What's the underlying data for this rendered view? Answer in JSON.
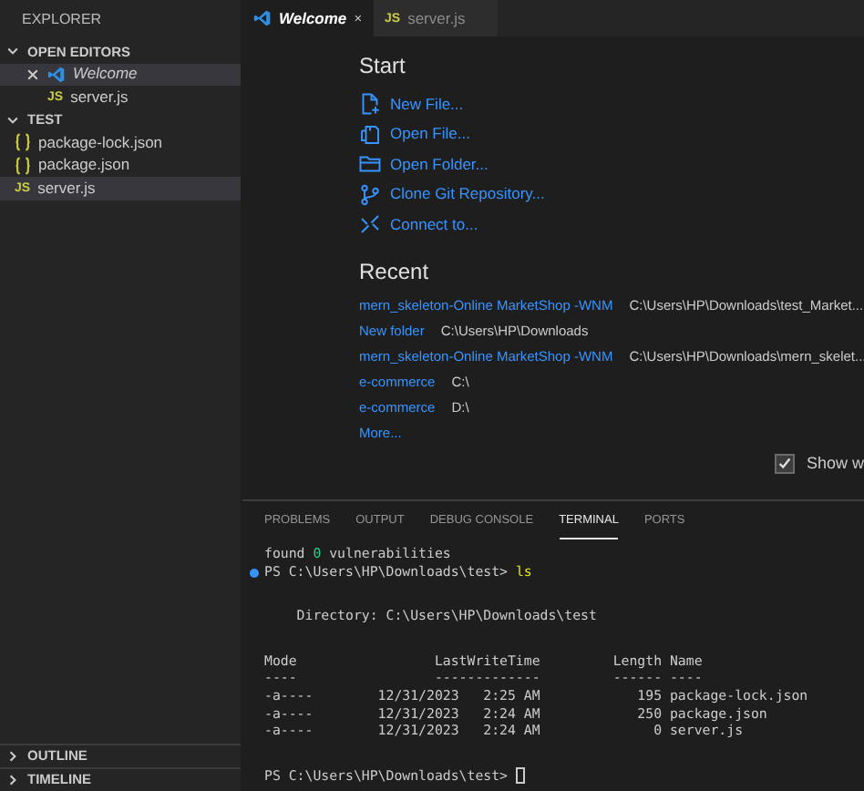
{
  "sidebar": {
    "title": "EXPLORER",
    "sections": [
      {
        "title": "OPEN EDITORS",
        "expanded": true,
        "items": [
          {
            "label": "Welcome",
            "kind": "welcome",
            "selected": true
          },
          {
            "label": "server.js",
            "kind": "js",
            "badge": "JS",
            "selected": false
          }
        ]
      },
      {
        "title": "TEST",
        "expanded": true,
        "items": [
          {
            "label": "package-lock.json",
            "kind": "json",
            "selected": false
          },
          {
            "label": "package.json",
            "kind": "json",
            "selected": false
          },
          {
            "label": "server.js",
            "kind": "js",
            "badge": "JS",
            "selected": true
          }
        ]
      }
    ],
    "bottom_sections": [
      {
        "title": "OUTLINE",
        "expanded": false
      },
      {
        "title": "TIMELINE",
        "expanded": false
      }
    ]
  },
  "tabs": [
    {
      "label": "Welcome",
      "kind": "welcome",
      "selected": true
    },
    {
      "label": "server.js",
      "kind": "js",
      "badge": "JS",
      "selected": false
    }
  ],
  "welcome": {
    "start_title": "Start",
    "start_items": [
      {
        "label": "New File...",
        "kind": "new"
      },
      {
        "label": "Open File...",
        "kind": "file"
      },
      {
        "label": "Open Folder...",
        "kind": "folder"
      },
      {
        "label": "Clone Git Repository...",
        "kind": "clone"
      },
      {
        "label": "Connect to...",
        "kind": "connect"
      }
    ],
    "recent_title": "Recent",
    "recent": [
      {
        "name": "mern_skeleton-Online MarketShop -WNM",
        "path": "C:\\Users\\HP\\Downloads\\test_Market..."
      },
      {
        "name": "New folder",
        "path": "C:\\Users\\HP\\Downloads"
      },
      {
        "name": "mern_skeleton-Online MarketShop -WNM",
        "path": "C:\\Users\\HP\\Downloads\\mern_skelet..."
      },
      {
        "name": "e-commerce",
        "path": "C:\\"
      },
      {
        "name": "e-commerce",
        "path": "D:\\"
      }
    ],
    "more": "More...",
    "show_on_startup": {
      "label": "Show w",
      "checked": true
    }
  },
  "panel": {
    "tabs": [
      {
        "label": "PROBLEMS",
        "selected": false
      },
      {
        "label": "OUTPUT",
        "selected": false
      },
      {
        "label": "DEBUG CONSOLE",
        "selected": false
      },
      {
        "label": "TERMINAL",
        "selected": true
      },
      {
        "label": "PORTS",
        "selected": false
      }
    ],
    "terminal": [
      {
        "lines": [
          {
            "parts": [
              {
                "text": "found ",
                "kind": "plain"
              },
              {
                "text": "0",
                "kind": "number"
              },
              {
                "text": " vulnerabilities",
                "kind": "plain"
              }
            ]
          },
          {
            "marker": true,
            "parts": [
              {
                "text": "PS C:\\Users\\HP\\Downloads\\test> ",
                "kind": "plain"
              },
              {
                "text": "ls",
                "kind": "command"
              }
            ]
          }
        ]
      },
      {
        "lines": [
          {
            "parts": [
              {
                "text": "    Directory: C:\\Users\\HP\\Downloads\\test",
                "kind": "plain"
              }
            ]
          }
        ]
      },
      {
        "lines": [
          {
            "parts": [
              {
                "text": "Mode                 LastWriteTime         Length Name",
                "kind": "plain"
              }
            ]
          },
          {
            "parts": [
              {
                "text": "----                 -------------         ------ ----",
                "kind": "plain"
              }
            ]
          },
          {
            "parts": [
              {
                "text": "-a----        12/31/2023   2:25 AM            195 package-lock.json",
                "kind": "plain"
              }
            ]
          },
          {
            "parts": [
              {
                "text": "-a----        12/31/2023   2:24 AM            250 package.json",
                "kind": "plain"
              }
            ]
          },
          {
            "parts": [
              {
                "text": "-a----        12/31/2023   2:24 AM              0 server.js",
                "kind": "plain"
              }
            ]
          }
        ]
      },
      {
        "lines": [
          {
            "cursor": true,
            "parts": [
              {
                "text": "PS C:\\Users\\HP\\Downloads\\test> ",
                "kind": "plain"
              }
            ]
          }
        ]
      }
    ]
  }
}
